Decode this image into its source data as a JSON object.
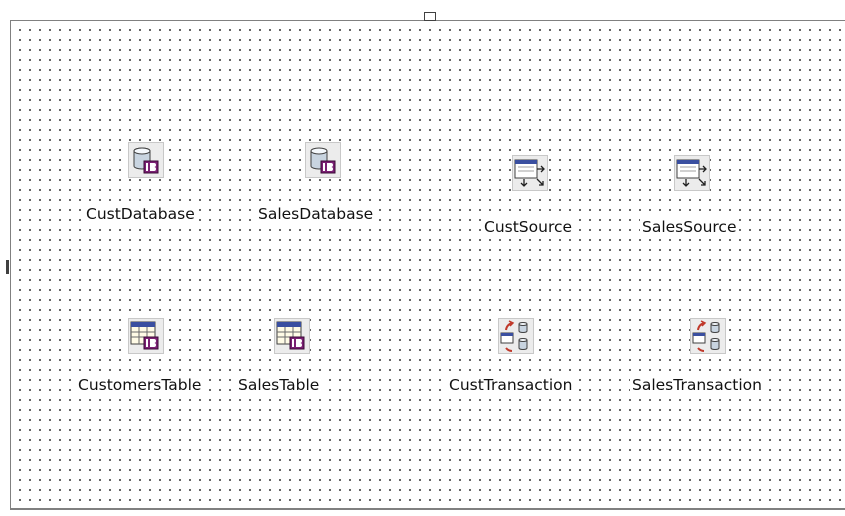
{
  "components": [
    {
      "name": "CustDatabase",
      "icon": "database-icon"
    },
    {
      "name": "SalesDatabase",
      "icon": "database-icon"
    },
    {
      "name": "CustSource",
      "icon": "datasource-icon"
    },
    {
      "name": "SalesSource",
      "icon": "datasource-icon"
    },
    {
      "name": "CustomersTable",
      "icon": "table-icon"
    },
    {
      "name": "SalesTable",
      "icon": "table-icon"
    },
    {
      "name": "CustTransaction",
      "icon": "transaction-icon"
    },
    {
      "name": "SalesTransaction",
      "icon": "transaction-icon"
    }
  ]
}
